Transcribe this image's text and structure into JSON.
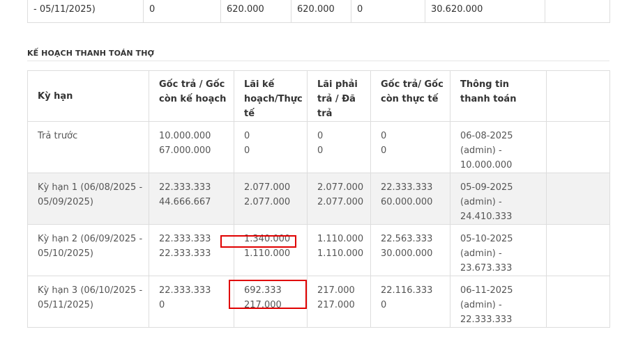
{
  "previous_table": {
    "cells": [
      "- 05/11/2025)",
      "0",
      "620.000",
      "620.000",
      "0",
      "30.620.000",
      ""
    ]
  },
  "section": {
    "title": "KẾ HOẠCH THANH TOÁN THỢ"
  },
  "plan_table": {
    "headers": {
      "ky_han": "Kỳ hạn",
      "goc_tra_goc_con": "Gốc trả / Gốc còn kế hoạch",
      "lai_ke_hoach": "Lãi kế hoạch/Thực tế",
      "lai_phai_tra": "Lãi phải trả / Đã trả",
      "goc_tra_thuc_te": "Gốc trả/ Gốc còn thực tế",
      "thong_tin": "Thông tin thanh toán",
      "extra": ""
    },
    "rows": [
      {
        "ky_han": "Trả trước",
        "goc_plan_1": "10.000.000",
        "goc_plan_2": "67.000.000",
        "lai_plan_1": "0",
        "lai_plan_2": "0",
        "lai_pay_1": "0",
        "lai_pay_2": "0",
        "goc_actual_1": "0",
        "goc_actual_2": "0",
        "info": "06-08-2025 (admin) - 10.000.000"
      },
      {
        "ky_han": "Kỳ hạn 1 (06/08/2025 - 05/09/2025)",
        "goc_plan_1": "22.333.333",
        "goc_plan_2": "44.666.667",
        "lai_plan_1": "2.077.000",
        "lai_plan_2": "2.077.000",
        "lai_pay_1": "2.077.000",
        "lai_pay_2": "2.077.000",
        "goc_actual_1": "22.333.333",
        "goc_actual_2": "60.000.000",
        "info": "05-09-2025 (admin) - 24.410.333"
      },
      {
        "ky_han": "Kỳ hạn 2 (06/09/2025 - 05/10/2025)",
        "goc_plan_1": "22.333.333",
        "goc_plan_2": "22.333.333",
        "lai_plan_1": "1.340.000",
        "lai_plan_2": "1.110.000",
        "lai_pay_1": "1.110.000",
        "lai_pay_2": "1.110.000",
        "goc_actual_1": "22.563.333",
        "goc_actual_2": "30.000.000",
        "info": "05-10-2025 (admin) - 23.673.333"
      },
      {
        "ky_han": "Kỳ hạn 3 (06/10/2025 - 05/11/2025)",
        "goc_plan_1": "22.333.333",
        "goc_plan_2": "0",
        "lai_plan_1": "692.333",
        "lai_plan_2": "217.000",
        "lai_pay_1": "217.000",
        "lai_pay_2": "217.000",
        "goc_actual_1": "22.116.333",
        "goc_actual_2": "0",
        "info": "06-11-2025 (admin) - 22.333.333"
      }
    ]
  },
  "colors": {
    "highlight": "#e00000",
    "border": "#dddddd",
    "shaded_row": "#f2f2f2"
  }
}
